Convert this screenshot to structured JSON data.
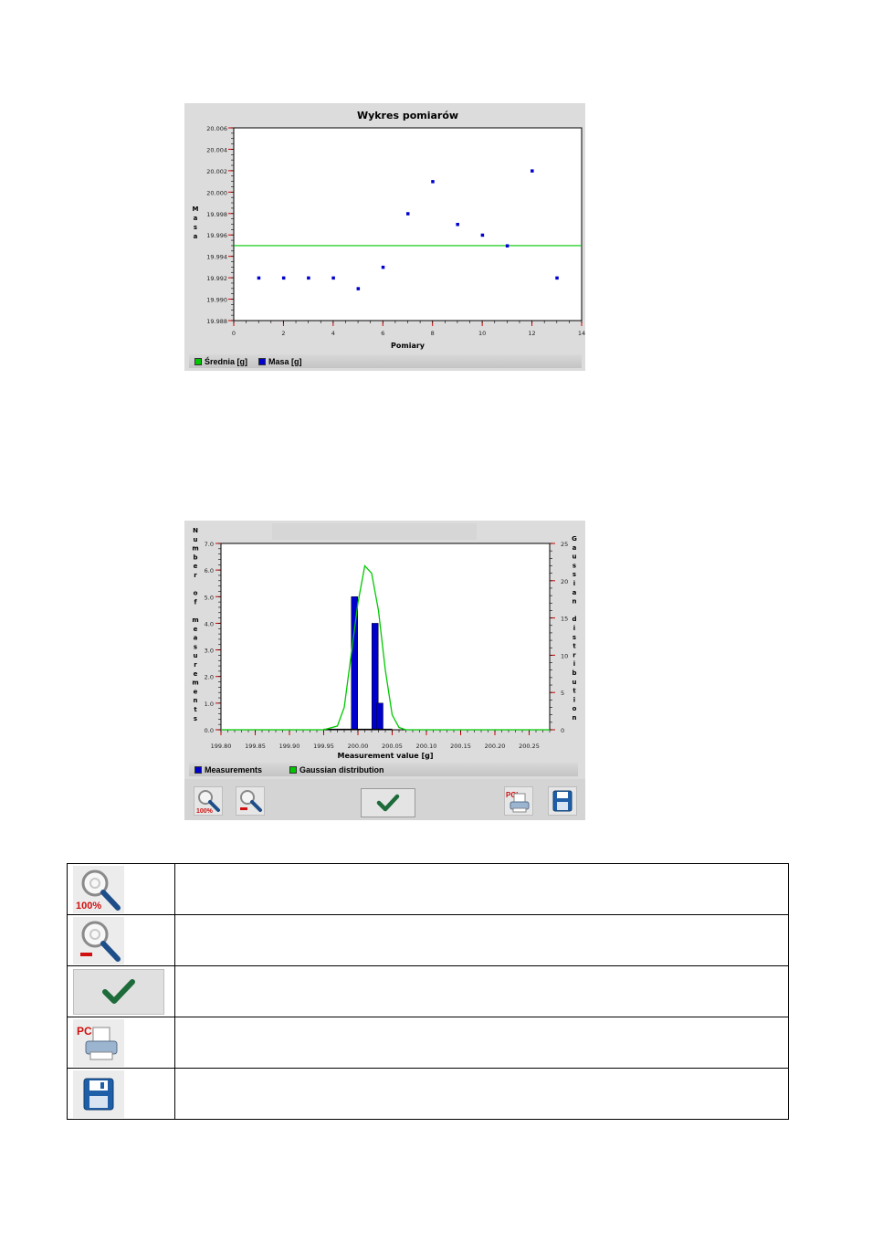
{
  "colors": {
    "average": "#00c800",
    "mass": "#0000cc",
    "bars": "#0000cc",
    "gauss": "#00c800",
    "redTick": "#d00000"
  },
  "chart_data": [
    {
      "type": "scatter",
      "title": "Wykres pomiarów",
      "xlabel": "Pomiary",
      "ylabel": "Masa",
      "xlim": [
        0,
        14
      ],
      "ylim": [
        19.988,
        20.006
      ],
      "xticks": [
        "0",
        "2",
        "4",
        "6",
        "8",
        "10",
        "12",
        "14"
      ],
      "yticks": [
        "20.006",
        "20.004",
        "20.002",
        "20.000",
        "19.998",
        "19.996",
        "19.994",
        "19.992",
        "19.990",
        "19.988"
      ],
      "series": [
        {
          "name": "Średnia [g]",
          "kind": "line",
          "y": 19.995
        },
        {
          "name": "Masa [g]",
          "kind": "points",
          "x": [
            1,
            2,
            3,
            4,
            5,
            6,
            7,
            8,
            9,
            10,
            11,
            12,
            13
          ],
          "y": [
            19.992,
            19.992,
            19.992,
            19.992,
            19.991,
            19.993,
            19.998,
            20.001,
            19.997,
            19.996,
            19.995,
            20.002,
            19.992
          ]
        }
      ],
      "legend": "bottom-left"
    },
    {
      "type": "bar",
      "title": "",
      "xlabel": "Measurement value [g]",
      "ylabel": "Number of measurements",
      "y2label": "Gaussian distribution",
      "xlim": [
        199.8,
        200.28
      ],
      "ylim": [
        0,
        7
      ],
      "y2lim": [
        0,
        25
      ],
      "xticks": [
        "199.80",
        "199.85",
        "199.90",
        "199.95",
        "200.00",
        "200.05",
        "200.10",
        "200.15",
        "200.20",
        "200.25"
      ],
      "yticks": [
        "7.0",
        "6.0",
        "5.0",
        "4.0",
        "3.0",
        "2.0",
        "1.0",
        "0.0"
      ],
      "y2ticks": [
        "25",
        "20",
        "15",
        "10",
        "5",
        "0"
      ],
      "series": [
        {
          "name": "Measurements",
          "kind": "bars",
          "x": [
            199.995,
            200.025,
            200.032
          ],
          "values": [
            5,
            4,
            1
          ]
        },
        {
          "name": "Gaussian distribution",
          "kind": "line",
          "x": [
            199.8,
            199.95,
            199.97,
            199.98,
            199.99,
            200.0,
            200.01,
            200.02,
            200.03,
            200.04,
            200.05,
            200.06,
            200.07,
            200.1,
            200.28
          ],
          "y": [
            0,
            0,
            0.5,
            3,
            10,
            17,
            22,
            21,
            16,
            8,
            2,
            0.3,
            0,
            0,
            0
          ]
        }
      ],
      "legend": "bottom-left"
    }
  ],
  "toolbar": {
    "zoom100_icon": "zoom-100-icon",
    "zoomout_icon": "zoom-out-icon",
    "ok_icon": "checkmark-icon",
    "print_icon": "pcl-printer-icon",
    "save_icon": "floppy-disk-icon"
  },
  "icon_table": [
    {
      "icon": "zoom-100-icon",
      "description": ""
    },
    {
      "icon": "zoom-out-icon",
      "description": ""
    },
    {
      "icon": "checkmark-icon",
      "description": ""
    },
    {
      "icon": "pcl-printer-icon",
      "description": ""
    },
    {
      "icon": "floppy-disk-icon",
      "description": ""
    }
  ],
  "labels": {
    "percent100": "100%",
    "pcl": "PCL"
  }
}
